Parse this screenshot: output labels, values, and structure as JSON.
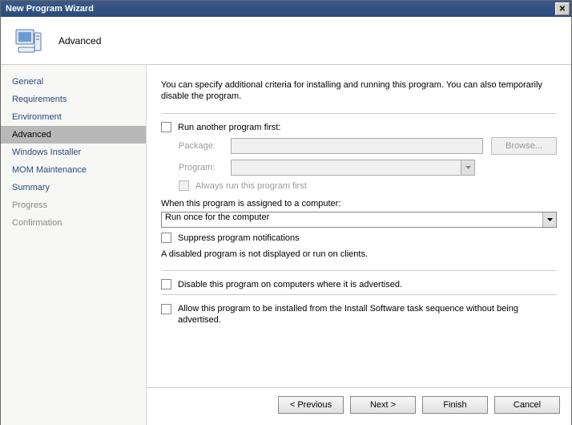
{
  "window": {
    "title": "New Program Wizard"
  },
  "header": {
    "page_title": "Advanced"
  },
  "sidebar": {
    "items": [
      {
        "label": "General",
        "state": "link"
      },
      {
        "label": "Requirements",
        "state": "link"
      },
      {
        "label": "Environment",
        "state": "link"
      },
      {
        "label": "Advanced",
        "state": "selected"
      },
      {
        "label": "Windows Installer",
        "state": "link"
      },
      {
        "label": "MOM Maintenance",
        "state": "link"
      },
      {
        "label": "Summary",
        "state": "link"
      },
      {
        "label": "Progress",
        "state": "muted"
      },
      {
        "label": "Confirmation",
        "state": "muted"
      }
    ]
  },
  "main": {
    "intro": "You can specify additional criteria for installing and running this program. You can also temporarily disable the program.",
    "run_another_first": {
      "checked": false,
      "label": "Run another program first:"
    },
    "package_label": "Package:",
    "package_value": "",
    "program_label": "Program:",
    "program_value": "",
    "browse_label": "Browse...",
    "always_run_first": {
      "checked": false,
      "label": "Always run this program first"
    },
    "assigned_label": "When this program is assigned to a computer:",
    "assigned_value": "Run once for the computer",
    "suppress": {
      "checked": false,
      "label": "Suppress program notifications"
    },
    "disabled_note": "A disabled program is not displayed or run on clients.",
    "disable_program": {
      "checked": false,
      "label": "Disable this program on computers where it is advertised."
    },
    "allow_ts": {
      "checked": false,
      "label": "Allow this program to be installed from the Install Software task sequence without being advertised."
    }
  },
  "footer": {
    "previous": "< Previous",
    "next": "Next >",
    "finish": "Finish",
    "cancel": "Cancel"
  }
}
